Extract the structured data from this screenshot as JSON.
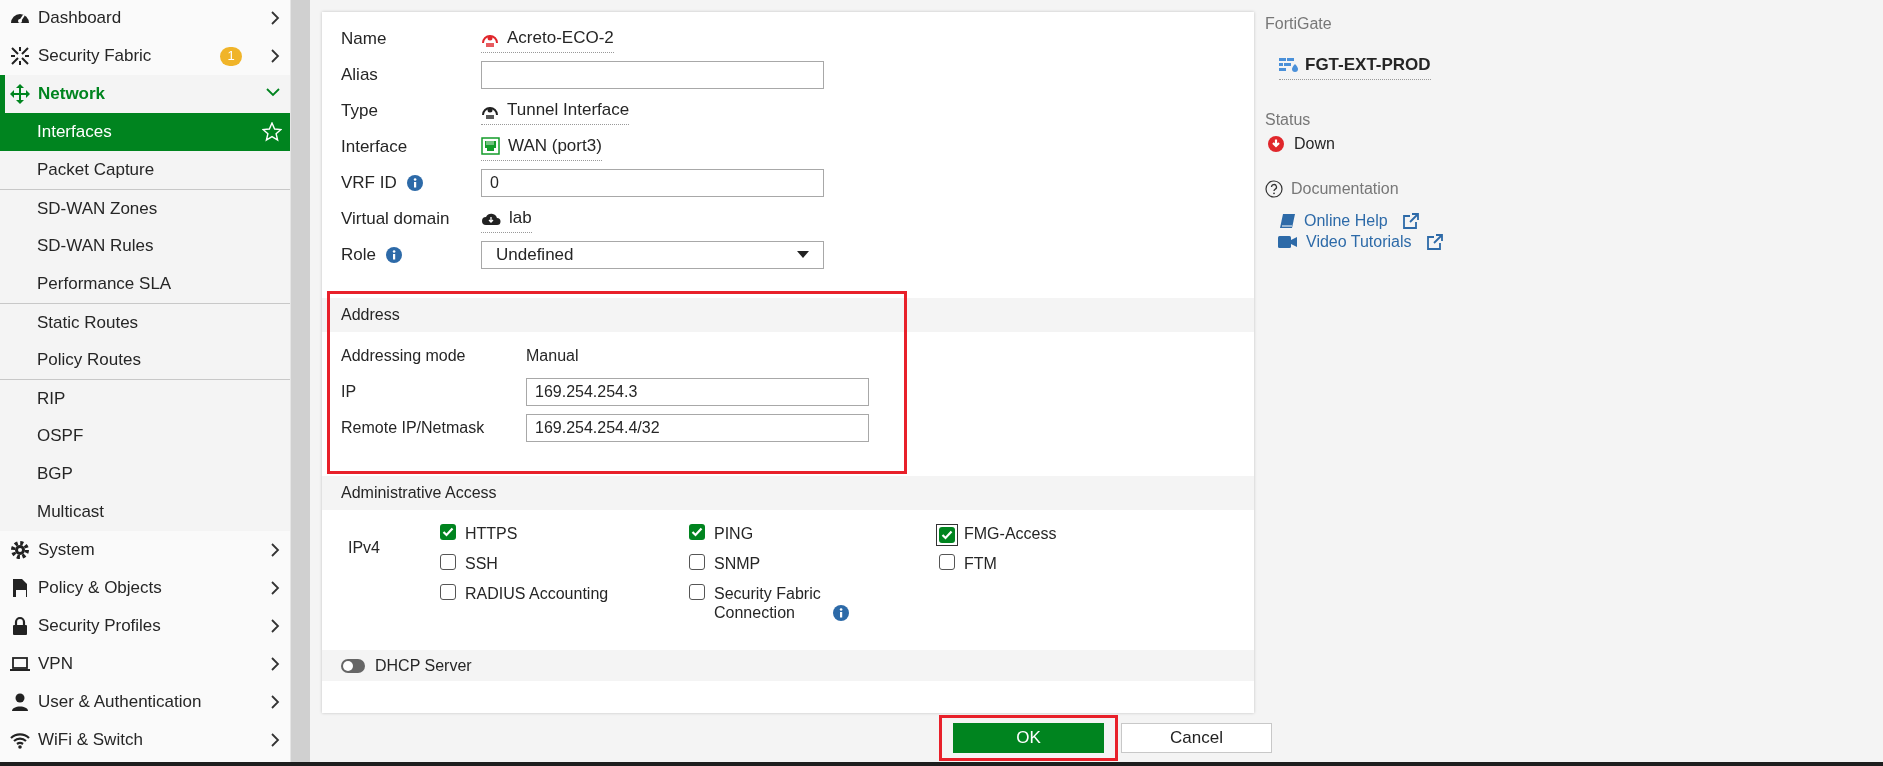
{
  "sidebar": {
    "items": [
      {
        "label": "Dashboard",
        "expanded": false
      },
      {
        "label": "Security Fabric",
        "badge": "1",
        "expanded": false
      },
      {
        "label": "Network",
        "expanded": true,
        "children": [
          {
            "label": "Interfaces",
            "selected": true,
            "group_start": false
          },
          {
            "label": "Packet Capture",
            "selected": false,
            "group_start": false
          },
          {
            "label": "SD-WAN Zones",
            "selected": false,
            "group_start": true
          },
          {
            "label": "SD-WAN Rules",
            "selected": false,
            "group_start": false
          },
          {
            "label": "Performance SLA",
            "selected": false,
            "group_start": false
          },
          {
            "label": "Static Routes",
            "selected": false,
            "group_start": true
          },
          {
            "label": "Policy Routes",
            "selected": false,
            "group_start": false
          },
          {
            "label": "RIP",
            "selected": false,
            "group_start": true
          },
          {
            "label": "OSPF",
            "selected": false,
            "group_start": false
          },
          {
            "label": "BGP",
            "selected": false,
            "group_start": false
          },
          {
            "label": "Multicast",
            "selected": false,
            "group_start": false
          }
        ]
      },
      {
        "label": "System",
        "expanded": false
      },
      {
        "label": "Policy & Objects",
        "expanded": false
      },
      {
        "label": "Security Profiles",
        "expanded": false
      },
      {
        "label": "VPN",
        "expanded": false
      },
      {
        "label": "User & Authentication",
        "expanded": false
      },
      {
        "label": "WiFi & Switch",
        "expanded": false
      }
    ]
  },
  "form": {
    "rows": [
      {
        "label": "Name",
        "info": false,
        "kind": "text",
        "value": "Acreto-ECO-2"
      },
      {
        "label": "Alias",
        "info": false,
        "kind": "input"
      },
      {
        "label": "Type",
        "info": false,
        "kind": "text",
        "value": "Tunnel Interface"
      },
      {
        "label": "Interface",
        "info": false,
        "kind": "text",
        "value": "WAN (port3)"
      },
      {
        "label": "VRF ID",
        "info": true,
        "kind": "input",
        "value": "0"
      },
      {
        "label": "Virtual domain",
        "info": false,
        "kind": "text",
        "value": "lab"
      },
      {
        "label": "Role",
        "info": true,
        "kind": "select",
        "value": "Undefined"
      }
    ]
  },
  "address": {
    "title": "Address",
    "highlighted": true,
    "rows": [
      {
        "label": "Addressing mode",
        "kind": "text",
        "value": "Manual"
      },
      {
        "label": "IP",
        "kind": "input",
        "value": "169.254.254.3"
      },
      {
        "label": "Remote IP/Netmask",
        "kind": "input",
        "value": "169.254.254.4/32"
      }
    ]
  },
  "admin_access": {
    "title": "Administrative Access",
    "protocol": "IPv4",
    "options": [
      {
        "label": "HTTPS",
        "checked": true,
        "focused": false,
        "info": false
      },
      {
        "label": "PING",
        "checked": true,
        "focused": false,
        "info": false
      },
      {
        "label": "FMG-Access",
        "checked": true,
        "focused": true,
        "info": false
      },
      {
        "label": "SSH",
        "checked": false,
        "focused": false,
        "info": false
      },
      {
        "label": "SNMP",
        "checked": false,
        "focused": false,
        "info": false
      },
      {
        "label": "FTM",
        "checked": false,
        "focused": false,
        "info": false
      },
      {
        "label": "RADIUS Accounting",
        "checked": false,
        "focused": false,
        "info": false
      },
      {
        "label": "Security Fabric Connection",
        "checked": false,
        "focused": false,
        "info": true
      }
    ]
  },
  "dhcp_server": {
    "label": "DHCP Server",
    "on": false
  },
  "buttons": [
    {
      "label": "OK",
      "kind": "primary",
      "highlighted": true
    },
    {
      "label": "Cancel",
      "kind": "secondary",
      "highlighted": false
    }
  ],
  "info_panel": {
    "device_heading": "FortiGate",
    "device": "FGT-EXT-PROD",
    "status_heading": "Status",
    "status": "Down",
    "up": false,
    "docs_heading": "Documentation",
    "links": [
      {
        "label": "Online Help"
      },
      {
        "label": "Video Tutorials"
      }
    ]
  }
}
